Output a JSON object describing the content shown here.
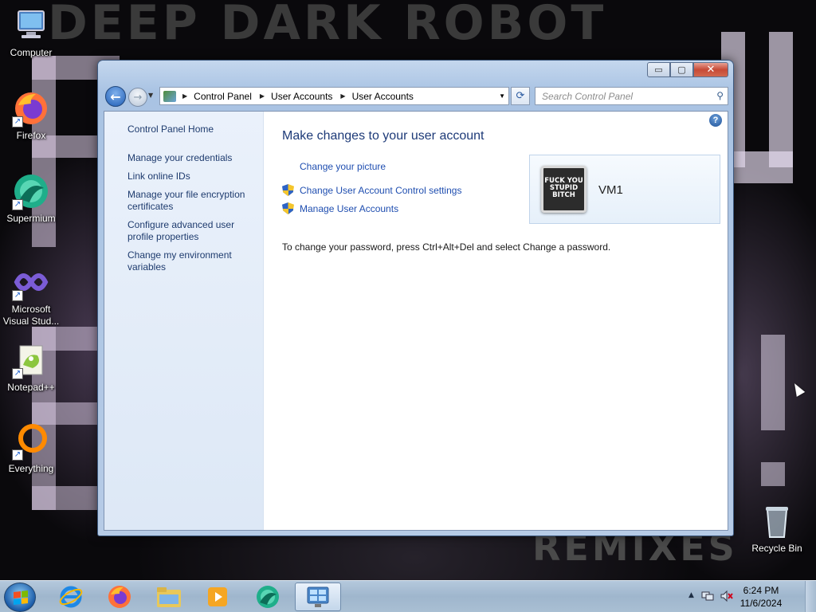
{
  "wallpaper": {
    "top_text": "DEEP DARK ROBOT",
    "bottom_text": "REMIXES"
  },
  "desktop_icons": [
    {
      "label": "Computer",
      "icon": "computer-icon"
    },
    {
      "label": "Firefox",
      "icon": "firefox-icon"
    },
    {
      "label": "Supermium",
      "icon": "supermium-icon"
    },
    {
      "label": "Microsoft Visual Stud...",
      "icon": "visual-studio-icon"
    },
    {
      "label": "Notepad++",
      "icon": "notepadplusplus-icon"
    },
    {
      "label": "Everything",
      "icon": "everything-icon"
    },
    {
      "label": "Recycle Bin",
      "icon": "recycle-bin-icon"
    }
  ],
  "window": {
    "controls": {
      "minimize": "▭",
      "maximize": "▢",
      "close": "✕"
    },
    "breadcrumbs": [
      "Control Panel",
      "User Accounts",
      "User Accounts"
    ],
    "search_placeholder": "Search Control Panel",
    "left_pane": {
      "home": "Control Panel Home",
      "links": [
        "Manage your credentials",
        "Link online IDs",
        "Manage your file encryption certificates",
        "Configure advanced user profile properties",
        "Change my environment variables"
      ]
    },
    "main": {
      "title": "Make changes to your user account",
      "tasks": [
        {
          "label": "Change your picture",
          "shield": false
        },
        {
          "label": "Change User Account Control settings",
          "shield": true
        },
        {
          "label": "Manage User Accounts",
          "shield": true
        }
      ],
      "account": {
        "name": "VM1",
        "picture_text": "FUCK YOU STUPID BITCH"
      },
      "password_hint": "To change your password, press Ctrl+Alt+Del and select Change a password."
    }
  },
  "taskbar": {
    "pinned": [
      {
        "name": "internet-explorer",
        "icon": "internet-explorer-icon"
      },
      {
        "name": "firefox",
        "icon": "firefox-icon"
      },
      {
        "name": "explorer",
        "icon": "folder-icon"
      },
      {
        "name": "media-player",
        "icon": "media-player-icon"
      },
      {
        "name": "supermium",
        "icon": "supermium-icon"
      },
      {
        "name": "control-panel",
        "icon": "control-panel-icon",
        "active": true
      }
    ],
    "clock": {
      "time": "6:24 PM",
      "date": "11/6/2024"
    }
  },
  "colors": {
    "link": "#1f4eb0",
    "title": "#1d3a78",
    "left_pane_link": "#1e3b6e"
  }
}
